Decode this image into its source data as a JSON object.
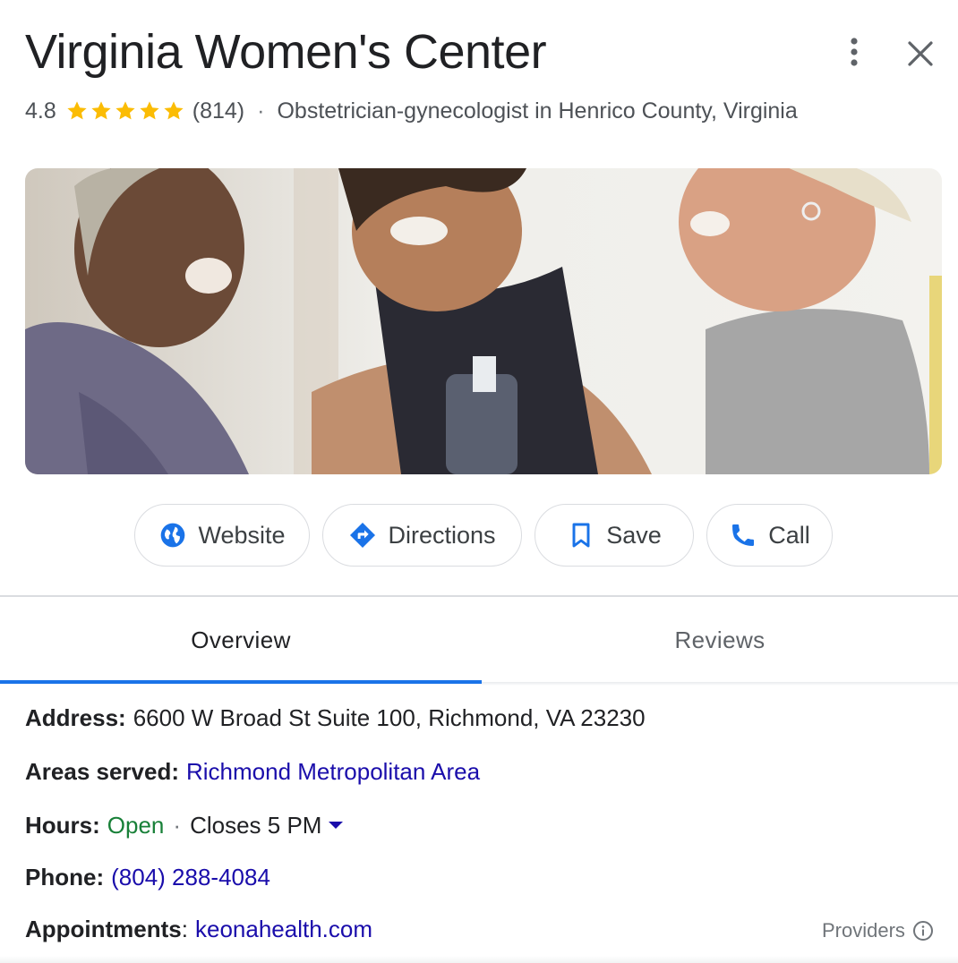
{
  "header": {
    "title": "Virginia Women's Center",
    "rating": "4.8",
    "review_count": "(814)",
    "stars_filled": 5,
    "category": "Obstetrician-gynecologist in Henrico County, Virginia",
    "separator": "·"
  },
  "actions": {
    "website": "Website",
    "directions": "Directions",
    "save": "Save",
    "call": "Call"
  },
  "tabs": {
    "overview": "Overview",
    "reviews": "Reviews",
    "active": "Overview"
  },
  "details": {
    "address_label": "Address:",
    "address_value": "6600 W Broad St Suite 100, Richmond, VA 23230",
    "areas_label": "Areas served:",
    "areas_value": "Richmond Metropolitan Area",
    "hours_label": "Hours:",
    "hours_status": "Open",
    "hours_sep": "·",
    "hours_close": "Closes 5 PM",
    "phone_label": "Phone:",
    "phone_value": "(804) 288-4084",
    "appointments_label": "Appointments",
    "appointments_colon": ":",
    "appointments_value": "keonahealth.com",
    "providers": "Providers"
  },
  "colors": {
    "link": "#1a0dab",
    "open": "#188038",
    "accent": "#1a73e8",
    "star": "#fbbc04"
  },
  "icons": {
    "website": "globe-icon",
    "directions": "directions-icon",
    "save": "bookmark-icon",
    "call": "phone-icon",
    "more": "more-vert-icon",
    "close": "close-icon",
    "info": "info-icon"
  }
}
